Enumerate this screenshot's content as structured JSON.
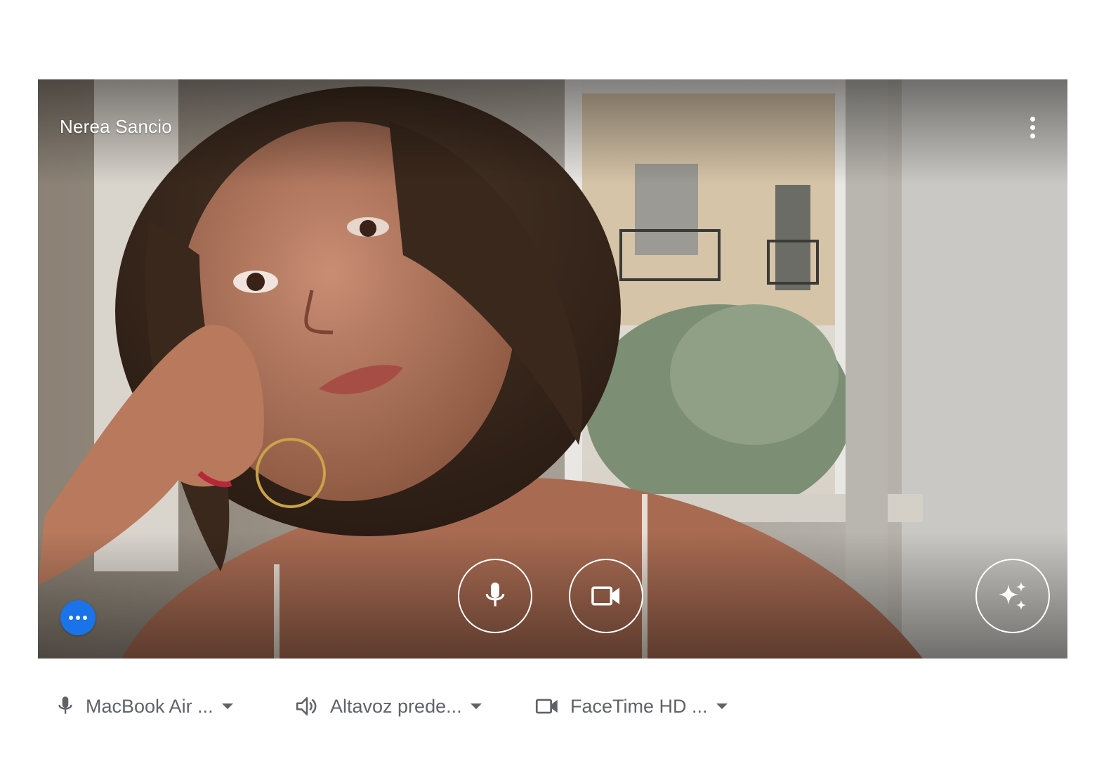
{
  "preview": {
    "participant_name": "Nerea Sancio",
    "icons": {
      "more": "more-vert-icon",
      "mic": "mic-icon",
      "camera": "videocam-icon",
      "effects": "sparkle-icon",
      "activity": "more-horiz-icon"
    },
    "accent_color": "#1a73e8"
  },
  "devices": {
    "microphone": {
      "label": "MacBook Air ...",
      "icon": "mic-icon"
    },
    "speaker": {
      "label": "Altavoz prede...",
      "icon": "speaker-icon"
    },
    "camera": {
      "label": "FaceTime HD ...",
      "icon": "videocam-icon"
    }
  }
}
